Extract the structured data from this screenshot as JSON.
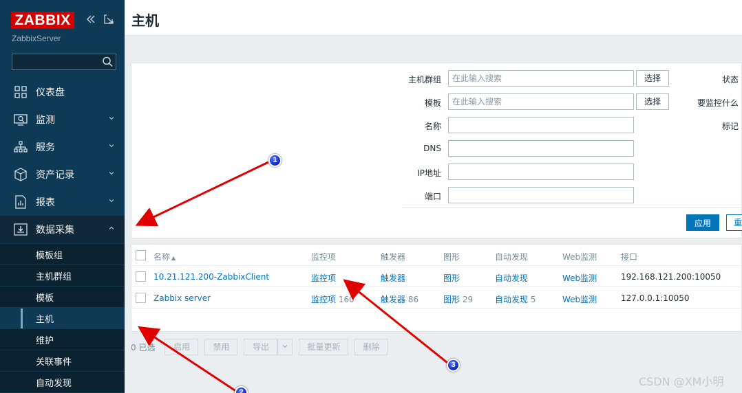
{
  "sidebar": {
    "logo": "ZABBIX",
    "server": "ZabbixServer",
    "collapse_icon": "double-chevron-left-icon",
    "kiosk_icon": "expand-icon",
    "search_placeholder": "",
    "menu": [
      {
        "label": "仪表盘",
        "icon": "dashboard-icon",
        "expandable": false
      },
      {
        "label": "监测",
        "icon": "monitoring-icon",
        "expandable": true
      },
      {
        "label": "服务",
        "icon": "services-icon",
        "expandable": true
      },
      {
        "label": "资产记录",
        "icon": "inventory-icon",
        "expandable": true
      },
      {
        "label": "报表",
        "icon": "reports-icon",
        "expandable": true
      },
      {
        "label": "数据采集",
        "icon": "data-collection-icon",
        "expandable": true,
        "expanded": true
      }
    ],
    "submenu": [
      "模板组",
      "主机群组",
      "模板",
      "主机",
      "维护",
      "关联事件",
      "自动发现"
    ],
    "selected_submenu": "主机"
  },
  "header": {
    "title": "主机"
  },
  "filter": {
    "host_groups_label": "主机群组",
    "host_groups_placeholder": "在此输入搜索",
    "templates_label": "模板",
    "templates_placeholder": "在此输入搜索",
    "name_label": "名称",
    "dns_label": "DNS",
    "ip_label": "IP地址",
    "port_label": "端口",
    "select_label": "选择",
    "status_label": "状态",
    "monitored_by_label": "要监控什么",
    "tags_label": "标记",
    "apply_label": "应用",
    "reset_label": "重"
  },
  "table": {
    "headers": [
      "名称",
      "监控项",
      "触发器",
      "图形",
      "自动发现",
      "Web监测",
      "接口"
    ],
    "sort_indicator": "▲",
    "rows": [
      {
        "name": "10.21.121.200-ZabbixClient",
        "items": "监控项",
        "items_count": "",
        "triggers": "触发器",
        "triggers_count": "",
        "graphs": "图形",
        "graphs_count": "",
        "discovery": "自动发现",
        "discovery_count": "",
        "web": "Web监测",
        "interface": "192.168.121.200:10050"
      },
      {
        "name": "Zabbix server",
        "items": "监控项",
        "items_count": "160",
        "triggers": "触发器",
        "triggers_count": "86",
        "graphs": "图形",
        "graphs_count": "29",
        "discovery": "自动发现",
        "discovery_count": "5",
        "web": "Web监测",
        "interface": "127.0.0.1:10050"
      }
    ]
  },
  "actions": {
    "selected": "0 已选",
    "enable": "启用",
    "disable": "禁用",
    "export": "导出",
    "mass_update": "批量更新",
    "delete": "删除"
  },
  "annotations": {
    "markers": [
      "1",
      "3",
      "2"
    ],
    "arrow_color": "#e00000"
  },
  "watermark": "CSDN @XM小明",
  "colors": {
    "sidebar_bg": "#0e3a55",
    "logo_bg": "#d40000",
    "link": "#0275b8",
    "primary_button": "#0275b8"
  }
}
